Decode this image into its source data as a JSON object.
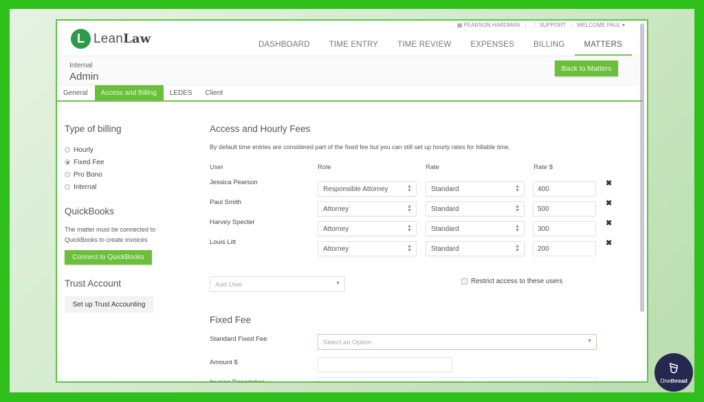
{
  "top_links": {
    "firm": "PEARSON HARDMAN",
    "support": "SUPPORT",
    "welcome": "WELCOME PAUL"
  },
  "logo": {
    "icon_letter": "L",
    "text_light": "Lean",
    "text_bold": "Law"
  },
  "nav": {
    "items": [
      {
        "label": "DASHBOARD"
      },
      {
        "label": "TIME ENTRY"
      },
      {
        "label": "TIME REVIEW"
      },
      {
        "label": "EXPENSES"
      },
      {
        "label": "BILLING"
      },
      {
        "label": "MATTERS",
        "active": true
      }
    ]
  },
  "matter": {
    "subtitle": "Internal",
    "title": "Admin",
    "back_button": "Back to Matters"
  },
  "tabs": [
    {
      "label": "General"
    },
    {
      "label": "Access and Billing",
      "active": true
    },
    {
      "label": "LEDES"
    },
    {
      "label": "Client"
    }
  ],
  "billing_type": {
    "title": "Type of billing",
    "options": [
      {
        "label": "Hourly",
        "checked": false
      },
      {
        "label": "Fixed Fee",
        "checked": true
      },
      {
        "label": "Pro Bono",
        "checked": false
      },
      {
        "label": "Internal",
        "checked": false
      }
    ]
  },
  "quickbooks": {
    "title": "QuickBooks",
    "description_line1": "The matter must be connected to",
    "description_line2": "QuickBooks to create invoices",
    "button": "Connect to QuickBooks"
  },
  "trust": {
    "title": "Trust Account",
    "button": "Set up Trust Accounting"
  },
  "access": {
    "title": "Access and Hourly Fees",
    "description": "By default time entries are considered part of the fixed fee but you can still set up hourly rates for billable time.",
    "columns": {
      "user": "User",
      "role": "Role",
      "rate": "Rate",
      "rate_amount": "Rate $"
    },
    "rows": [
      {
        "user": "Jessica Pearson",
        "role": "Responsible Attorney",
        "rate": "Standard",
        "amount": "400"
      },
      {
        "user": "Paul Smith",
        "role": "Attorney",
        "rate": "Standard",
        "amount": "500"
      },
      {
        "user": "Harvey Specter",
        "role": "Attorney",
        "rate": "Standard",
        "amount": "300"
      },
      {
        "user": "Louis Litt",
        "role": "Attorney",
        "rate": "Standard",
        "amount": "200"
      }
    ],
    "add_user_placeholder": "Add User",
    "restrict_label": "Restrict access to these users",
    "restrict_checked": false
  },
  "fixed_fee": {
    "title": "Fixed Fee",
    "standard_label": "Standard Fixed Fee",
    "standard_placeholder": "Select an Option",
    "amount_label": "Amount $",
    "amount_value": "",
    "invoice_label": "Invoice Description",
    "invoice_value": ""
  },
  "watermark": {
    "text_light": "One",
    "text_bold": "thread"
  },
  "colors": {
    "accent": "#6bbf3a",
    "frame": "#2fbf1a",
    "logo": "#2e9b48",
    "badge": "#26284f"
  }
}
